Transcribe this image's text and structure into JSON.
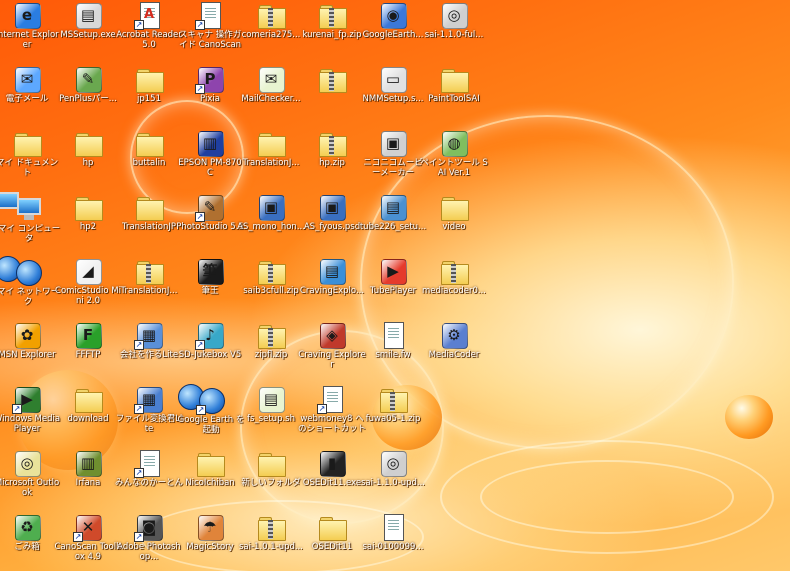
{
  "desktop": {
    "icons": [
      {
        "label": "Internet Explorer",
        "icon": "internet-explorer-icon",
        "type": "app",
        "color": "#2a7de1",
        "glyph": "e",
        "shortcut": false
      },
      {
        "label": "MSSetup.exe",
        "icon": "setup-exe-icon",
        "type": "app",
        "color": "#d8d8d8",
        "glyph": "▤",
        "shortcut": false
      },
      {
        "label": "Acrobat Reader 5.0",
        "icon": "acrobat-reader-icon",
        "type": "doc",
        "color": "#d52b1e",
        "glyph": "A",
        "shortcut": true
      },
      {
        "label": "スキャナ 操作ガイド CanoScan",
        "icon": "scanner-guide-icon",
        "type": "doc",
        "color": "#ffffff",
        "glyph": "",
        "shortcut": true
      },
      {
        "label": "comeria275...",
        "icon": "zip-folder-icon",
        "type": "zip",
        "color": "#f4cd52",
        "glyph": "",
        "shortcut": false
      },
      {
        "label": "kurenai_fp.zip",
        "icon": "zip-folder-icon",
        "type": "zip",
        "color": "#f4cd52",
        "glyph": "",
        "shortcut": false
      },
      {
        "label": "GoogleEarth...",
        "icon": "google-earth-setup-icon",
        "type": "app",
        "color": "#3b78d8",
        "glyph": "◉",
        "shortcut": false
      },
      {
        "label": "sai-1.1.0-ful...",
        "icon": "cd-installer-icon",
        "type": "app",
        "color": "#cfcfcf",
        "glyph": "◎",
        "shortcut": false
      },
      {
        "label": "電子メール",
        "icon": "email-icon",
        "type": "app",
        "color": "#5da8ff",
        "glyph": "✉",
        "shortcut": false
      },
      {
        "label": "PenPlusパー...",
        "icon": "penplus-icon",
        "type": "app",
        "color": "#6aa84f",
        "glyph": "✎",
        "shortcut": false
      },
      {
        "label": "jp151",
        "icon": "folder-icon",
        "type": "folder",
        "color": "#f4cd52",
        "glyph": "",
        "shortcut": false
      },
      {
        "label": "Pixia",
        "icon": "pixia-icon",
        "type": "app",
        "color": "#8e44ad",
        "glyph": "P",
        "shortcut": true
      },
      {
        "label": "MailChecker...",
        "icon": "mailchecker-icon",
        "type": "app",
        "color": "#e8f4d0",
        "glyph": "✉",
        "shortcut": false
      },
      {
        "label": "",
        "icon": "zip-folder-icon",
        "type": "zip",
        "color": "#f4cd52",
        "glyph": "",
        "shortcut": false
      },
      {
        "label": "NMMSetup.s...",
        "icon": "nmm-setup-icon",
        "type": "app",
        "color": "#e0e0e0",
        "glyph": "▭",
        "shortcut": false
      },
      {
        "label": "PaintToolSAI",
        "icon": "folder-icon",
        "type": "folder",
        "color": "#f4cd52",
        "glyph": "",
        "shortcut": false
      },
      {
        "label": "マイ ドキュメント",
        "icon": "my-documents-icon",
        "type": "folder",
        "color": "#f4cd52",
        "glyph": "",
        "shortcut": false
      },
      {
        "label": "hp",
        "icon": "folder-icon",
        "type": "folder",
        "color": "#f4cd52",
        "glyph": "",
        "shortcut": false
      },
      {
        "label": "buttalin",
        "icon": "folder-icon",
        "type": "folder",
        "color": "#f4cd52",
        "glyph": "",
        "shortcut": false
      },
      {
        "label": "EPSON PM-870C",
        "icon": "epson-printer-icon",
        "type": "app",
        "color": "#1f3fa0",
        "glyph": "▥",
        "shortcut": false
      },
      {
        "label": "TranslationJ...",
        "icon": "folder-icon",
        "type": "folder",
        "color": "#f4cd52",
        "glyph": "",
        "shortcut": false
      },
      {
        "label": "hp.zip",
        "icon": "zip-folder-icon",
        "type": "zip",
        "color": "#f4cd52",
        "glyph": "",
        "shortcut": false
      },
      {
        "label": "ニコニコムービーメーカー",
        "icon": "nico-movie-maker-icon",
        "type": "app",
        "color": "#d0d0d0",
        "glyph": "▣",
        "shortcut": false
      },
      {
        "label": "ペイントツール SAI Ver.1",
        "icon": "paint-tool-sai-icon",
        "type": "app",
        "color": "#7fbf5f",
        "glyph": "◍",
        "shortcut": false
      },
      {
        "label": "マイ コンピュータ",
        "icon": "my-computer-icon",
        "type": "monitor",
        "color": "#1c6fc8",
        "glyph": "",
        "shortcut": false
      },
      {
        "label": "hp2",
        "icon": "folder-icon",
        "type": "folder",
        "color": "#f4cd52",
        "glyph": "",
        "shortcut": false
      },
      {
        "label": "TranslationJP",
        "icon": "folder-icon",
        "type": "folder",
        "color": "#f4cd52",
        "glyph": "",
        "shortcut": false
      },
      {
        "label": "PhotoStudio 5.5",
        "icon": "photostudio-icon",
        "type": "app",
        "color": "#b07030",
        "glyph": "✎",
        "shortcut": true
      },
      {
        "label": "AS_mono_hon...",
        "icon": "psd-image-icon",
        "type": "app",
        "color": "#3a6fc0",
        "glyph": "▣",
        "shortcut": false
      },
      {
        "label": "AS_fyous.psd",
        "icon": "psd-image-icon",
        "type": "app",
        "color": "#3a6fc0",
        "glyph": "▣",
        "shortcut": false
      },
      {
        "label": "tube226_setu...",
        "icon": "tube-setup-icon",
        "type": "app",
        "color": "#4a90d0",
        "glyph": "▤",
        "shortcut": false
      },
      {
        "label": "video",
        "icon": "folder-icon",
        "type": "folder",
        "color": "#f4cd52",
        "glyph": "",
        "shortcut": false
      },
      {
        "label": "マイ ネットワーク",
        "icon": "my-network-icon",
        "type": "globe",
        "color": "#2f7ed8",
        "glyph": "",
        "shortcut": false
      },
      {
        "label": "ComicStudio Mini 2.0",
        "icon": "comicstudio-icon",
        "type": "app",
        "color": "#f0f0f0",
        "glyph": "◢",
        "shortcut": false
      },
      {
        "label": "TranslationJ...",
        "icon": "zip-folder-icon",
        "type": "zip",
        "color": "#f4cd52",
        "glyph": "",
        "shortcut": false
      },
      {
        "label": "筆王",
        "icon": "fudeoh-icon",
        "type": "app",
        "color": "#1a1a1a",
        "glyph": "筆",
        "shortcut": false
      },
      {
        "label": "saib3cfull.zip",
        "icon": "zip-folder-icon",
        "type": "zip",
        "color": "#f4cd52",
        "glyph": "",
        "shortcut": false
      },
      {
        "label": "CravingExplo...",
        "icon": "craving-explorer-setup-icon",
        "type": "app",
        "color": "#3a8fd8",
        "glyph": "▤",
        "shortcut": false
      },
      {
        "label": "TubePlayer",
        "icon": "tubeplayer-icon",
        "type": "app",
        "color": "#e53b2c",
        "glyph": "▶",
        "shortcut": false
      },
      {
        "label": "mediacoder0...",
        "icon": "zip-folder-icon",
        "type": "zip",
        "color": "#f4cd52",
        "glyph": "",
        "shortcut": false
      },
      {
        "label": "MSN Explorer",
        "icon": "msn-explorer-icon",
        "type": "app",
        "color": "#f2a000",
        "glyph": "✿",
        "shortcut": false
      },
      {
        "label": "FFFTP",
        "icon": "ffftp-icon",
        "type": "app",
        "color": "#2aa02a",
        "glyph": "F",
        "shortcut": false
      },
      {
        "label": "会社を作るLite",
        "icon": "company-lite-icon",
        "type": "app",
        "color": "#5a90d8",
        "glyph": "▦",
        "shortcut": true
      },
      {
        "label": "SD-Jukebox V5",
        "icon": "sd-jukebox-icon",
        "type": "app",
        "color": "#38a8c8",
        "glyph": "♪",
        "shortcut": true
      },
      {
        "label": "zipfl.zip",
        "icon": "zip-folder-icon",
        "type": "zip",
        "color": "#f4cd52",
        "glyph": "",
        "shortcut": false
      },
      {
        "label": "Craving Explorer",
        "icon": "craving-explorer-icon",
        "type": "app",
        "color": "#c0392b",
        "glyph": "◈",
        "shortcut": false
      },
      {
        "label": "smile.fw",
        "icon": "document-icon",
        "type": "doc",
        "color": "#ffffff",
        "glyph": "",
        "shortcut": false
      },
      {
        "label": "MediaCoder",
        "icon": "mediacoder-icon",
        "type": "app",
        "color": "#5a7fd0",
        "glyph": "⚙",
        "shortcut": false
      },
      {
        "label": "Windows Media Player",
        "icon": "windows-media-player-icon",
        "type": "app",
        "color": "#2f7f2f",
        "glyph": "▶",
        "shortcut": true
      },
      {
        "label": "download",
        "icon": "folder-icon",
        "type": "folder",
        "color": "#f4cd52",
        "glyph": "",
        "shortcut": false
      },
      {
        "label": "ファイル変換君Lite",
        "icon": "file-converter-icon",
        "type": "app",
        "color": "#4a7fd0",
        "glyph": "▦",
        "shortcut": true
      },
      {
        "label": "Google Earth を起動",
        "icon": "google-earth-icon",
        "type": "globe",
        "color": "#2f7ed8",
        "glyph": "",
        "shortcut": true
      },
      {
        "label": "fs_setup.sh",
        "icon": "script-file-icon",
        "type": "app",
        "color": "#e8f4d0",
        "glyph": "▤",
        "shortcut": false
      },
      {
        "label": "webmoney8 へのショートカット",
        "icon": "webmoney-shortcut-icon",
        "type": "doc",
        "color": "#ffffff",
        "glyph": "",
        "shortcut": true
      },
      {
        "label": "fuwa05-1.zip",
        "icon": "zip-folder-icon",
        "type": "zip",
        "color": "#f4cd52",
        "glyph": "",
        "shortcut": false
      },
      {
        "label": "Microsoft Outlook",
        "icon": "outlook-icon",
        "type": "app",
        "color": "#e9e29a",
        "glyph": "◎",
        "shortcut": false
      },
      {
        "label": "Irfana",
        "icon": "irfana-icon",
        "type": "app",
        "color": "#6f8f2f",
        "glyph": "▥",
        "shortcut": false
      },
      {
        "label": "みんなのかーとん",
        "icon": "minna-carton-icon",
        "type": "doc",
        "color": "#ffffff",
        "glyph": "",
        "shortcut": true
      },
      {
        "label": "NicoIchiban",
        "icon": "folder-icon",
        "type": "folder",
        "color": "#f4cd52",
        "glyph": "",
        "shortcut": false
      },
      {
        "label": "新しいフォルダ",
        "icon": "new-folder-icon",
        "type": "folder",
        "color": "#f4cd52",
        "glyph": "",
        "shortcut": false
      },
      {
        "label": "OSEDit11.exe",
        "icon": "osedit-exe-icon",
        "type": "app",
        "color": "#222222",
        "glyph": "▮",
        "shortcut": false
      },
      {
        "label": "sai-1.1.0-upd...",
        "icon": "cd-installer-icon",
        "type": "app",
        "color": "#cfcfcf",
        "glyph": "◎",
        "shortcut": false
      },
      {
        "label": "ごみ箱",
        "icon": "recycle-bin-icon",
        "type": "app",
        "color": "#4fae4f",
        "glyph": "♻",
        "shortcut": false
      },
      {
        "label": "CanoScan Toolbox 4.9",
        "icon": "canoscan-toolbox-icon",
        "type": "app",
        "color": "#d04a2a",
        "glyph": "✕",
        "shortcut": true
      },
      {
        "label": "Adobe Photoshop...",
        "icon": "photoshop-camera-icon",
        "type": "app",
        "color": "#555555",
        "glyph": "◙",
        "shortcut": true
      },
      {
        "label": "MagicStory",
        "icon": "magicstory-icon",
        "type": "app",
        "color": "#e0843a",
        "glyph": "☂",
        "shortcut": false
      },
      {
        "label": "sai-1.0.1-upd...",
        "icon": "zip-folder-icon",
        "type": "zip",
        "color": "#f4cd52",
        "glyph": "",
        "shortcut": false
      },
      {
        "label": "OSEDit11",
        "icon": "folder-icon",
        "type": "folder",
        "color": "#f4cd52",
        "glyph": "",
        "shortcut": false
      },
      {
        "label": "sai-0100099...",
        "icon": "text-file-icon",
        "type": "doc",
        "color": "#ffffff",
        "glyph": "",
        "shortcut": false
      }
    ]
  }
}
